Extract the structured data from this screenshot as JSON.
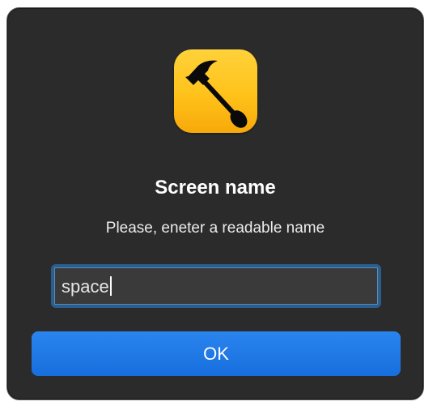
{
  "dialog": {
    "title": "Screen name",
    "message": "Please, eneter a readable name",
    "input": {
      "value": "space",
      "placeholder": ""
    },
    "ok_label": "OK",
    "app_icon": "hammer-spoon-icon"
  },
  "colors": {
    "dialog_background": "#2b2b2b",
    "accent": "#1a75e6",
    "icon_background": "#ffc21a"
  }
}
